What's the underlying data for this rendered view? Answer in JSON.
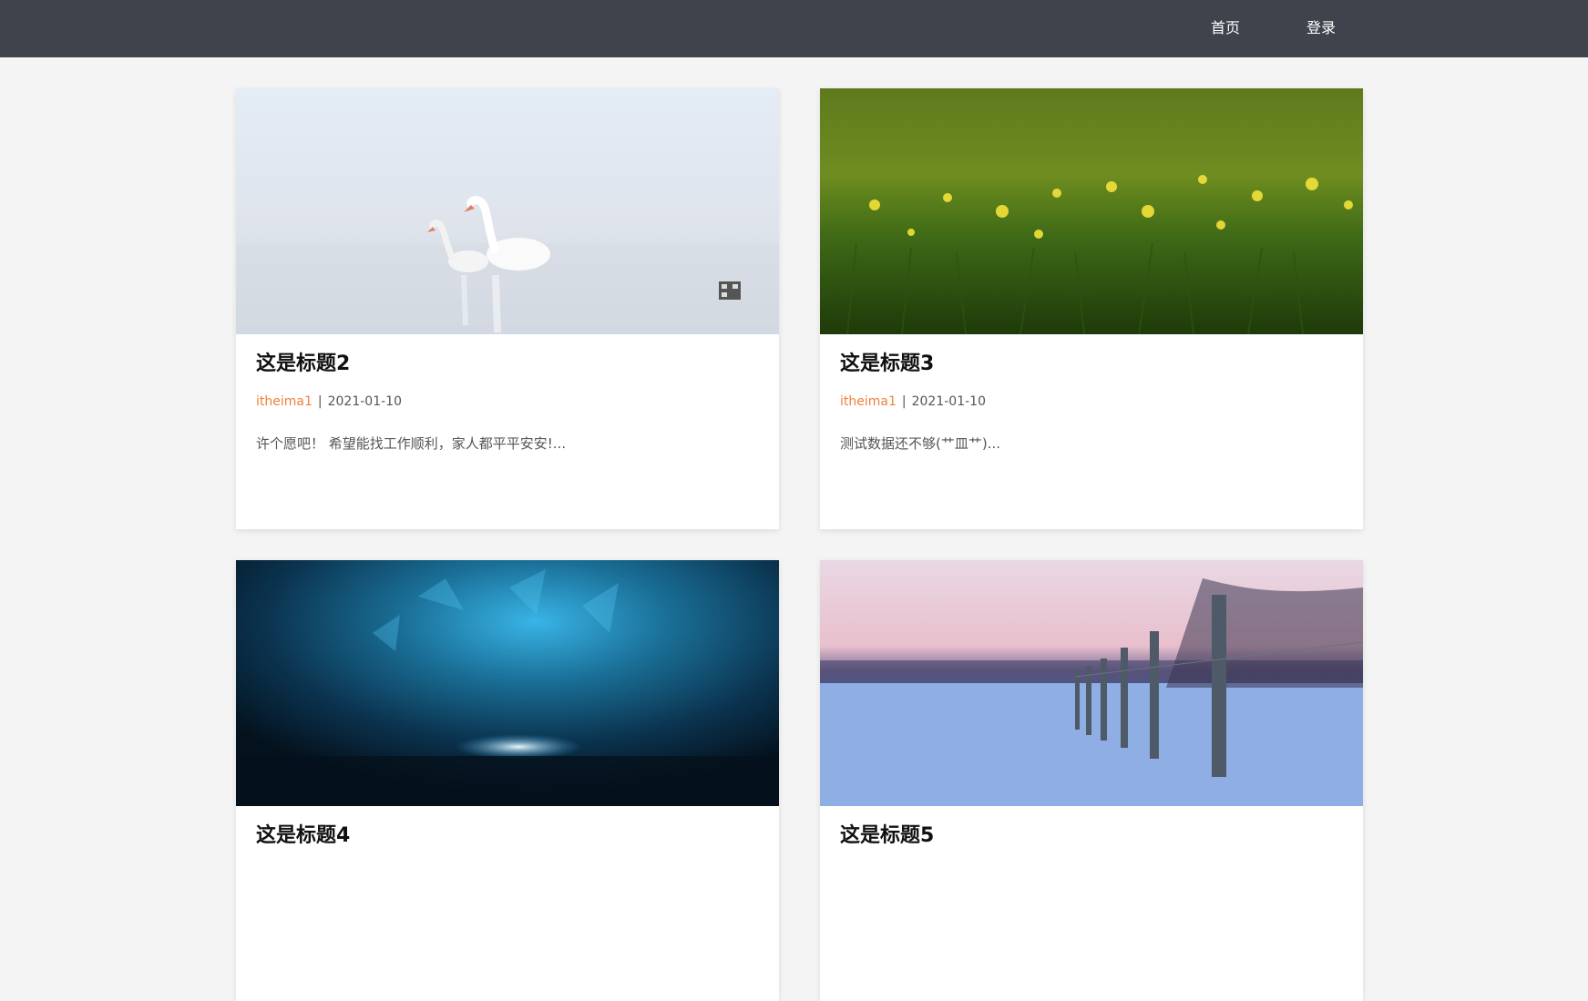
{
  "nav": {
    "home_label": "首页",
    "login_label": "登录"
  },
  "posts": [
    {
      "title": "这是标题2",
      "author": "itheima1",
      "separator": "|",
      "date": "2021-01-10",
      "excerpt": "许个愿吧！ 希望能找工作顺利，家人都平平安安!..."
    },
    {
      "title": "这是标题3",
      "author": "itheima1",
      "separator": "|",
      "date": "2021-01-10",
      "excerpt": "测试数据还不够(艹皿艹)..."
    },
    {
      "title": "这是标题4",
      "author": "",
      "separator": "",
      "date": "",
      "excerpt": ""
    },
    {
      "title": "这是标题5",
      "author": "",
      "separator": "",
      "date": "",
      "excerpt": ""
    }
  ],
  "colors": {
    "header_bg": "#3e434c",
    "page_bg": "#f4f4f4",
    "author": "#f0813a"
  }
}
